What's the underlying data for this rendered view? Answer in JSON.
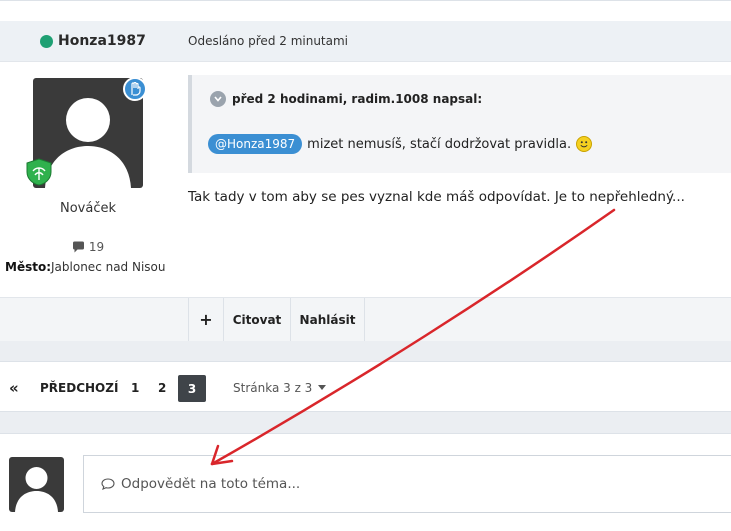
{
  "post": {
    "author": "Honza1987",
    "posted": "Odesláno před 2 minutami",
    "rank": "Nováček",
    "post_count": "19",
    "city_label": "Město:",
    "city_value": "Jablonec nad Nisou",
    "quote": {
      "header": "před 2 hodinami, radim.1008 napsal:",
      "mention": "@Honza1987",
      "text": "mizet nemusíš, stačí dodržovat pravidla."
    },
    "text": "Tak tady v tom aby se pes vyznal kde máš odpovídat. Je to nepřehledný...",
    "actions": {
      "plus": "+",
      "cite": "Citovat",
      "report": "Nahlásit"
    }
  },
  "pagination": {
    "first": "«",
    "prev": "PŘEDCHOZÍ",
    "pages": [
      "1",
      "2",
      "3"
    ],
    "current": "3",
    "info": "Stránka 3 z 3"
  },
  "reply": {
    "placeholder": "Odpovědět na toto téma..."
  },
  "colors": {
    "online": "#1ea073",
    "accent": "#3b8fd3",
    "annotation_arrow": "#d9262b"
  },
  "icons": [
    "online-dot-icon",
    "hand-badge-icon",
    "rank-shield-icon",
    "comment-icon",
    "chevron-down-icon",
    "smile-icon",
    "caret-down-icon",
    "speech-bubble-icon"
  ]
}
